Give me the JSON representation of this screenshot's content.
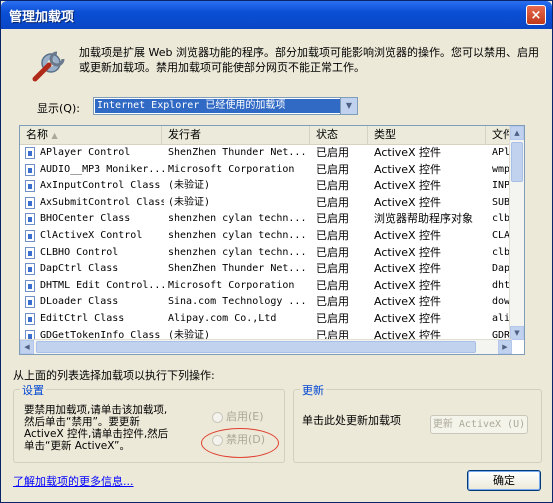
{
  "window": {
    "title": "管理加载项",
    "close": "×"
  },
  "description": "加载项是扩展 Web 浏览器功能的程序。部分加载项可能影响浏览器的操作。您可以禁用、启用或更新加载项。禁用加载项可能使部分网页不能正常工作。",
  "show": {
    "label": "显示(Q):",
    "value": "Internet Explorer 已经使用的加载项"
  },
  "table": {
    "columns": [
      "名称",
      "发行者",
      "状态",
      "类型",
      "文件"
    ],
    "rows": [
      [
        "APlayer Control",
        "ShenZhen Thunder Net...",
        "已启用",
        "ActiveX 控件",
        "APlaye"
      ],
      [
        "AUDIO__MP3 Moniker...",
        "Microsoft Corporation",
        "已启用",
        "ActiveX 控件",
        "wmp.dl"
      ],
      [
        "AxInputControl Class",
        "(未验证)",
        "已启用",
        "ActiveX 控件",
        "INPUTC"
      ],
      [
        "AxSubmitControl Class",
        "(未验证)",
        "已启用",
        "ActiveX 控件",
        "SUBMIT"
      ],
      [
        "BHOCenter Class",
        "shenzhen cylan techn...",
        "已启用",
        "浏览器帮助程序对象",
        "clbho."
      ],
      [
        "ClActiveX Control",
        "shenzhen cylan techn...",
        "已启用",
        "ActiveX 控件",
        "CLACTI"
      ],
      [
        "CLBHO Control",
        "shenzhen cylan techn...",
        "已启用",
        "ActiveX 控件",
        "clbho."
      ],
      [
        "DapCtrl Class",
        "ShenZhen Thunder Net...",
        "已启用",
        "ActiveX 控件",
        "DapCtr"
      ],
      [
        "DHTML Edit Control...",
        "Microsoft Corporation",
        "已启用",
        "ActiveX 控件",
        "dhtmle"
      ],
      [
        "DLoader Class",
        "Sina.com Technology ...",
        "已启用",
        "ActiveX 控件",
        "downlo"
      ],
      [
        "EditCtrl Class",
        "Alipay.com Co.,Ltd",
        "已启用",
        "ActiveX 控件",
        "aliedi"
      ],
      [
        "GDGetTokenInfo Class",
        "(未验证)",
        "已启用",
        "ActiveX 控件",
        "GDREAD"
      ]
    ]
  },
  "actions": {
    "label": "从上面的列表选择加载项以执行下列操作:"
  },
  "settings": {
    "title": "设置",
    "text": "要禁用加载项,请单击该加载项,然后单击“禁用”。要更新 ActiveX 控件,请单击控件,然后单击“更新 ActiveX”。",
    "enable": "启用(E)",
    "disable": "禁用(D)"
  },
  "update": {
    "title": "更新",
    "text": "单击此处更新加载项",
    "button": "更新 ActiveX (U)"
  },
  "footer": {
    "link": "了解加载项的更多信息...",
    "ok": "确定"
  }
}
